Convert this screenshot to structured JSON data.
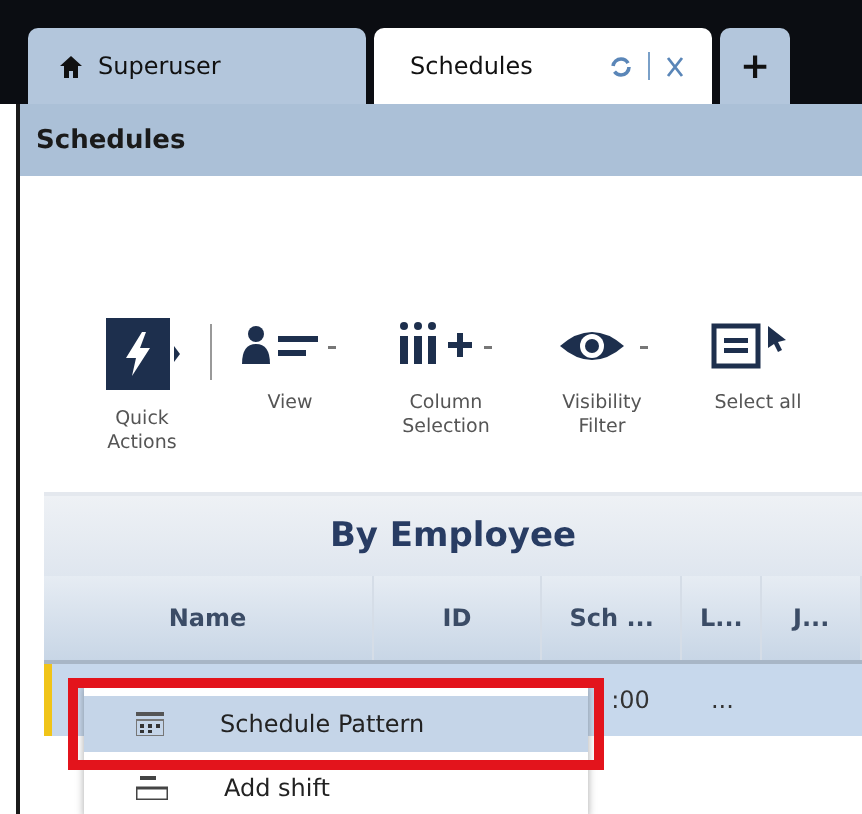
{
  "tabs": [
    {
      "label": "Superuser",
      "kind": "home",
      "selected": false
    },
    {
      "label": "Schedules",
      "kind": "page",
      "selected": true
    }
  ],
  "new_tab": "+",
  "panel": {
    "title": "Schedules"
  },
  "toolbar": [
    {
      "label": "Quick Actions",
      "kind": "quick",
      "dropdown": false
    },
    {
      "label": "View",
      "kind": "view",
      "dropdown": true
    },
    {
      "label": "Column Selection",
      "kind": "columns",
      "dropdown": true
    },
    {
      "label": "Visibility Filter",
      "kind": "eye",
      "dropdown": true
    },
    {
      "label": "Select all",
      "kind": "select",
      "dropdown": false
    }
  ],
  "table": {
    "group_title": "By Employee",
    "columns": [
      "Name",
      "ID",
      "Sch ...",
      "L...",
      "J..."
    ],
    "rows": [
      {
        "selected": true,
        "cells": [
          {},
          {},
          {
            "text": ":00"
          },
          {
            "text": "..."
          },
          {}
        ]
      }
    ]
  },
  "context_menu": [
    {
      "label": "Schedule Pattern",
      "kind": "pattern",
      "selected": true,
      "highlighted": true
    },
    {
      "label": "Add shift",
      "kind": "add",
      "selected": false,
      "highlighted": false
    }
  ]
}
